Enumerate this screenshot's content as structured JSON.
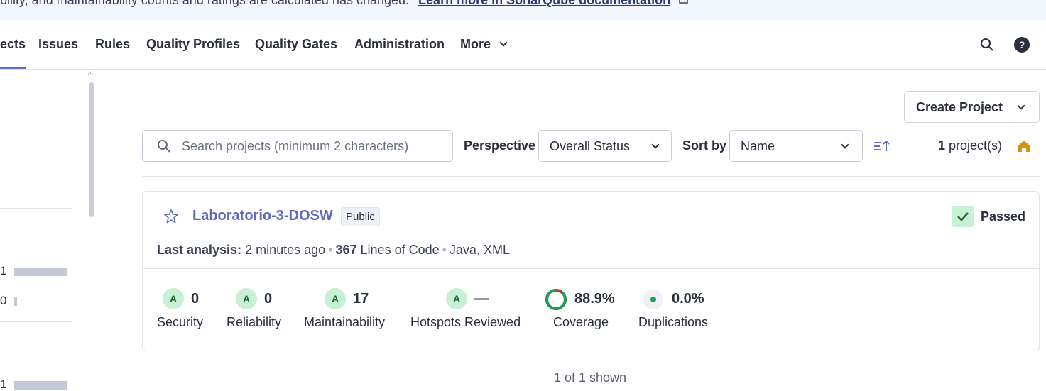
{
  "banner": {
    "text": "bility, and maintainability counts and ratings are calculated has changed.",
    "link": "Learn more in SonarQube documentation"
  },
  "nav": {
    "items": [
      "ects",
      "Issues",
      "Rules",
      "Quality Profiles",
      "Quality Gates",
      "Administration",
      "More"
    ]
  },
  "sidebar": {
    "rows": [
      {
        "count": "1",
        "bar_fraction": 1.0
      },
      {
        "count": "0",
        "bar_fraction": 0.05
      },
      {
        "count": "1",
        "bar_fraction": 1.0
      }
    ]
  },
  "toolbar": {
    "create_project": "Create Project",
    "search_placeholder": "Search projects (minimum 2 characters)",
    "perspective_label": "Perspective",
    "perspective_value": "Overall Status",
    "sort_label": "Sort by",
    "sort_value": "Name",
    "count_number": "1",
    "count_suffix": "project(s)"
  },
  "project": {
    "name": "Laboratorio-3-DOSW",
    "visibility": "Public",
    "gate_status": "Passed",
    "last_analysis_label": "Last analysis:",
    "last_analysis_value": "2 minutes ago",
    "lines_count": "367",
    "lines_label": "Lines of Code",
    "languages": "Java, XML",
    "metrics": [
      {
        "grade": "A",
        "value": "0",
        "label": "Security"
      },
      {
        "grade": "A",
        "value": "0",
        "label": "Reliability"
      },
      {
        "grade": "A",
        "value": "17",
        "label": "Maintainability"
      },
      {
        "grade": "A",
        "value": "—",
        "label": "Hotspots Reviewed"
      }
    ],
    "coverage": {
      "value": "88.9%",
      "label": "Coverage",
      "percent": 88.9
    },
    "duplications": {
      "value": "0.0%",
      "label": "Duplications"
    }
  },
  "footer": {
    "shown": "1 of 1 shown"
  },
  "colors": {
    "accent": "#5d6cd0",
    "pass_green": "#c8f0d4",
    "coverage_green": "#1f9e5a",
    "coverage_red": "#c0392b"
  }
}
